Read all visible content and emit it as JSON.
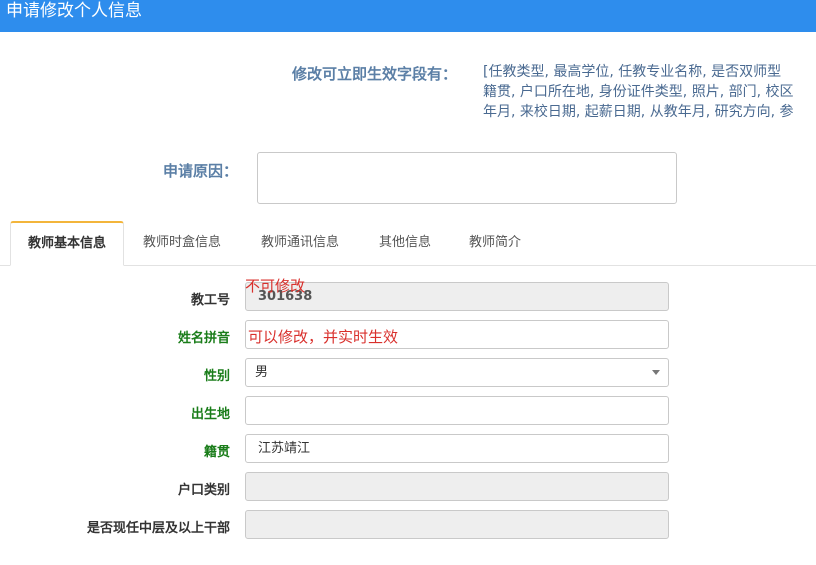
{
  "window": {
    "title": "申请修改个人信息"
  },
  "editable_fields": {
    "label": "修改可立即生效字段有：",
    "lines": [
      "[任教类型, 最高学位, 任教专业名称, 是否双师型",
      "籍贯, 户口所在地, 身份证件类型, 照片, 部门, 校区",
      "年月, 来校日期, 起薪日期, 从教年月, 研究方向, 参"
    ]
  },
  "reason": {
    "label": "申请原因：",
    "value": ""
  },
  "tabs": [
    {
      "label": "教师基本信息",
      "active": true
    },
    {
      "label": "教师时盒信息",
      "active": false
    },
    {
      "label": "教师通讯信息",
      "active": false
    },
    {
      "label": "其他信息",
      "active": false
    },
    {
      "label": "教师简介",
      "active": false
    }
  ],
  "form": {
    "staff_id": {
      "label": "教工号",
      "value": "301638"
    },
    "name_pinyin": {
      "label": "姓名拼音",
      "value": ""
    },
    "gender": {
      "label": "性别",
      "value": "男"
    },
    "birthplace": {
      "label": "出生地",
      "value": ""
    },
    "native_place": {
      "label": "籍贯",
      "value": "江苏靖江"
    },
    "hukou_type": {
      "label": "户口类别",
      "value": ""
    },
    "is_cadre": {
      "label": "是否现任中层及以上干部",
      "value": ""
    }
  },
  "annotations": {
    "not_editable": "不可修改",
    "editable": "可以修改，并实时生效"
  },
  "colors": {
    "titlebar": "#2e8ded",
    "editable_label": "#1a7d1a",
    "annotation": "#d9302c",
    "tab_active_top": "#f3b53b"
  }
}
